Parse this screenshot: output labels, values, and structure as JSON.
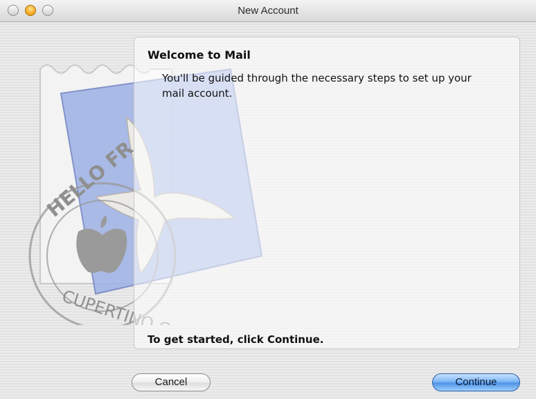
{
  "window": {
    "title": "New Account"
  },
  "panel": {
    "heading": "Welcome to Mail",
    "body": "You'll be guided through the necessary steps to set up your mail account.",
    "footer": "To get started, click Continue."
  },
  "stamp": {
    "postmark_top": "HELLO FR",
    "postmark_bottom": "CUPERTINO CA"
  },
  "buttons": {
    "cancel": "Cancel",
    "continue": "Continue"
  },
  "colors": {
    "accent": "#4f93e6",
    "stamp_blue": "#9db1e6",
    "minimize": "#f2a016"
  },
  "icons": {
    "close": "close-button-icon",
    "minimize": "minimize-button-icon",
    "zoom": "zoom-button-icon",
    "stamp": "mail-stamp-icon"
  }
}
